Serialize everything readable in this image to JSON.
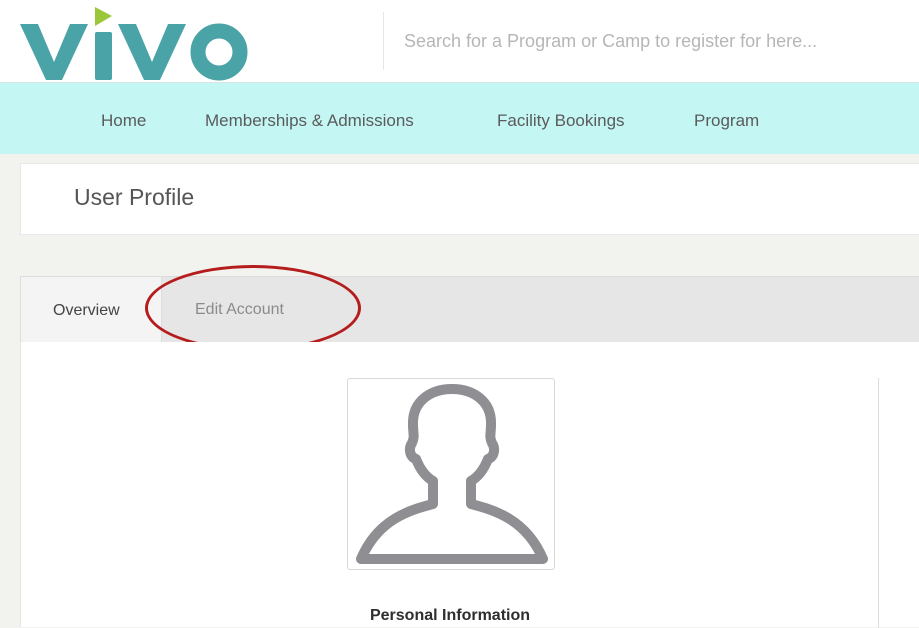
{
  "brand": {
    "logo_text": "VIVO",
    "colors": {
      "teal": "#4aa3a7",
      "accent": "#9bc83b",
      "nav_bg": "#c4f6f4",
      "highlight": "#b51d1d"
    }
  },
  "search": {
    "placeholder": "Search for a Program or Camp to register for here..."
  },
  "nav": {
    "items": [
      {
        "label": "Home"
      },
      {
        "label": "Memberships & Admissions"
      },
      {
        "label": "Facility Bookings"
      },
      {
        "label": "Program"
      }
    ]
  },
  "page": {
    "title": "User Profile"
  },
  "tabs": {
    "items": [
      {
        "label": "Overview",
        "active": true
      },
      {
        "label": "Edit Account",
        "active": false
      }
    ]
  },
  "profile": {
    "avatar_icon": "user-silhouette-icon",
    "section_heading": "Personal Information"
  }
}
